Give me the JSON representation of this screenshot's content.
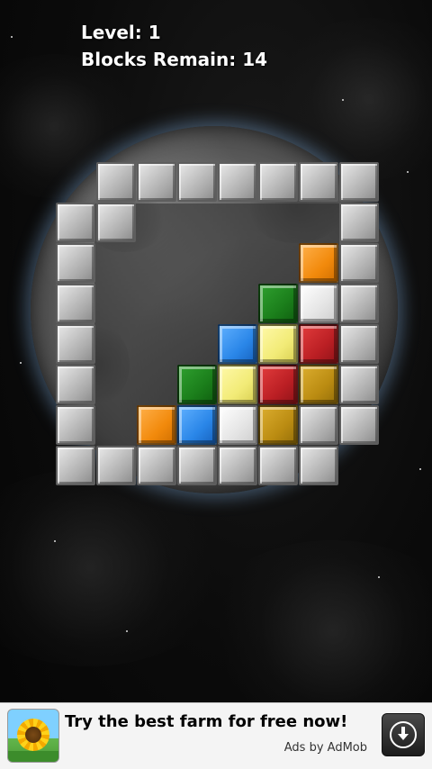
{
  "hud": {
    "level_label": "Level:",
    "level_value": "1",
    "blocks_label": "Blocks Remain:",
    "blocks_value": "14"
  },
  "board": {
    "cell_size": 45,
    "cols": 8,
    "rows": 8,
    "walls": [
      [
        1,
        0
      ],
      [
        2,
        0
      ],
      [
        3,
        0
      ],
      [
        4,
        0
      ],
      [
        5,
        0
      ],
      [
        6,
        0
      ],
      [
        7,
        0
      ],
      [
        0,
        1
      ],
      [
        1,
        1
      ],
      [
        7,
        1
      ],
      [
        0,
        2
      ],
      [
        7,
        2
      ],
      [
        0,
        3
      ],
      [
        7,
        3
      ],
      [
        0,
        4
      ],
      [
        7,
        4
      ],
      [
        0,
        5
      ],
      [
        7,
        5
      ],
      [
        0,
        6
      ],
      [
        6,
        6
      ],
      [
        7,
        6
      ],
      [
        0,
        7
      ],
      [
        1,
        7
      ],
      [
        2,
        7
      ],
      [
        3,
        7
      ],
      [
        4,
        7
      ],
      [
        5,
        7
      ],
      [
        6,
        7
      ]
    ],
    "blocks": [
      {
        "col": 6,
        "row": 2,
        "color": "orange"
      },
      {
        "col": 5,
        "row": 3,
        "color": "green"
      },
      {
        "col": 6,
        "row": 3,
        "color": "white"
      },
      {
        "col": 4,
        "row": 4,
        "color": "blue"
      },
      {
        "col": 5,
        "row": 4,
        "color": "yellow"
      },
      {
        "col": 6,
        "row": 4,
        "color": "red"
      },
      {
        "col": 3,
        "row": 5,
        "color": "green"
      },
      {
        "col": 4,
        "row": 5,
        "color": "yellow"
      },
      {
        "col": 5,
        "row": 5,
        "color": "red"
      },
      {
        "col": 6,
        "row": 5,
        "color": "gold"
      },
      {
        "col": 2,
        "row": 6,
        "color": "orange"
      },
      {
        "col": 3,
        "row": 6,
        "color": "blue"
      },
      {
        "col": 4,
        "row": 6,
        "color": "white"
      },
      {
        "col": 5,
        "row": 6,
        "color": "gold"
      }
    ]
  },
  "colors": {
    "orange": "#f28a0c",
    "white": "#e4e4e4",
    "green": "#1b7e1b",
    "blue": "#2a86e8",
    "yellow": "#f2eb77",
    "red": "#bb1f24",
    "gold": "#bb8c12",
    "wall": "#c9c9c9"
  },
  "ad": {
    "headline": "Try the best farm for free now!",
    "attribution": "Ads by AdMob",
    "icon": "sunflower-farm-icon",
    "action_icon": "download-icon"
  }
}
